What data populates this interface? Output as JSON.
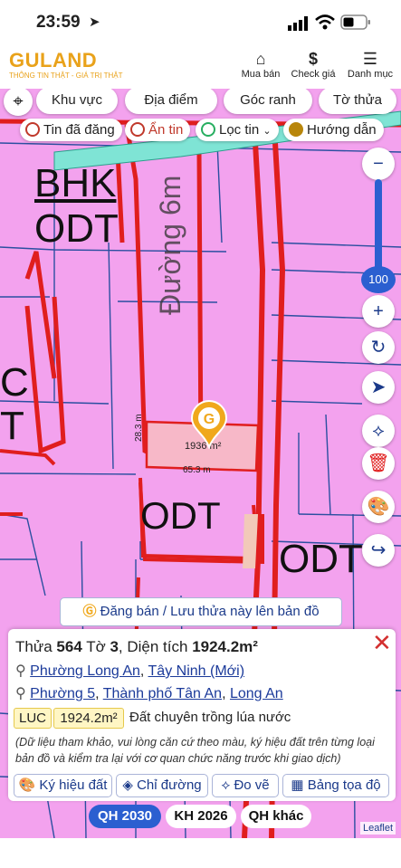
{
  "status_bar": {
    "time": "23:59"
  },
  "header": {
    "logo": "GULAND",
    "slogan": "THÔNG TIN THẬT - GIÁ TRỊ THẬT",
    "buttons": [
      {
        "label": "Mua bán",
        "icon": "house-icon"
      },
      {
        "label": "Check giá",
        "icon": "dollar-icon"
      },
      {
        "label": "Danh mục",
        "icon": "menu-icon"
      }
    ]
  },
  "search_tabs": [
    "Khu vực",
    "Địa điểm",
    "Góc ranh",
    "Tờ thửa"
  ],
  "filters": [
    {
      "label": "Tin đã đăng",
      "color": "#c0392b"
    },
    {
      "label": "Ẩn tin",
      "color": "#c0392b"
    },
    {
      "label": "Lọc tin",
      "color": "#27ae60"
    },
    {
      "label": "Hướng dẫn",
      "color": "#b8860b"
    }
  ],
  "map": {
    "zoom_level": "100",
    "labels": {
      "bhk": "BHK",
      "odt1": "ODT",
      "road": "Đường 6m",
      "c": "C",
      "t": "T",
      "odt2": "ODT",
      "odt3": "ODT",
      "dim_side": "28.3 m",
      "dim_bottom": "65.3 m",
      "area": "1936 m²"
    },
    "attribution": "Leaflet"
  },
  "post_button": "Đăng bán / Lưu thửa này lên bản đồ",
  "parcel": {
    "title_prefix": "Thửa ",
    "parcel_no": "564",
    "sheet_prefix": " Tờ ",
    "sheet_no": "3",
    "area_prefix": ", Diện tích ",
    "area": "1924.2m²",
    "address_new": {
      "ward": "Phường Long An",
      "sep": ", ",
      "province": "Tây Ninh (Mới)"
    },
    "address_old": {
      "ward": "Phường 5",
      "sep1": ", ",
      "city": "Thành phố Tân An",
      "sep2": ", ",
      "province": "Long An"
    },
    "land_code": "LUC",
    "land_area": "1924.2m²",
    "land_type": "Đất chuyên trồng lúa nước",
    "disclaimer": "(Dữ liệu tham khảo, vui lòng căn cứ theo màu, ký hiệu đất trên từng loại bản đồ và kiểm tra lại với cơ quan chức năng trước khi giao dịch)"
  },
  "actions": [
    "Ký hiệu đất",
    "Chỉ đường",
    "Đo vẽ",
    "Bảng tọa độ"
  ],
  "plan_tabs": [
    "QH 2030",
    "KH 2026",
    "QH khác"
  ]
}
